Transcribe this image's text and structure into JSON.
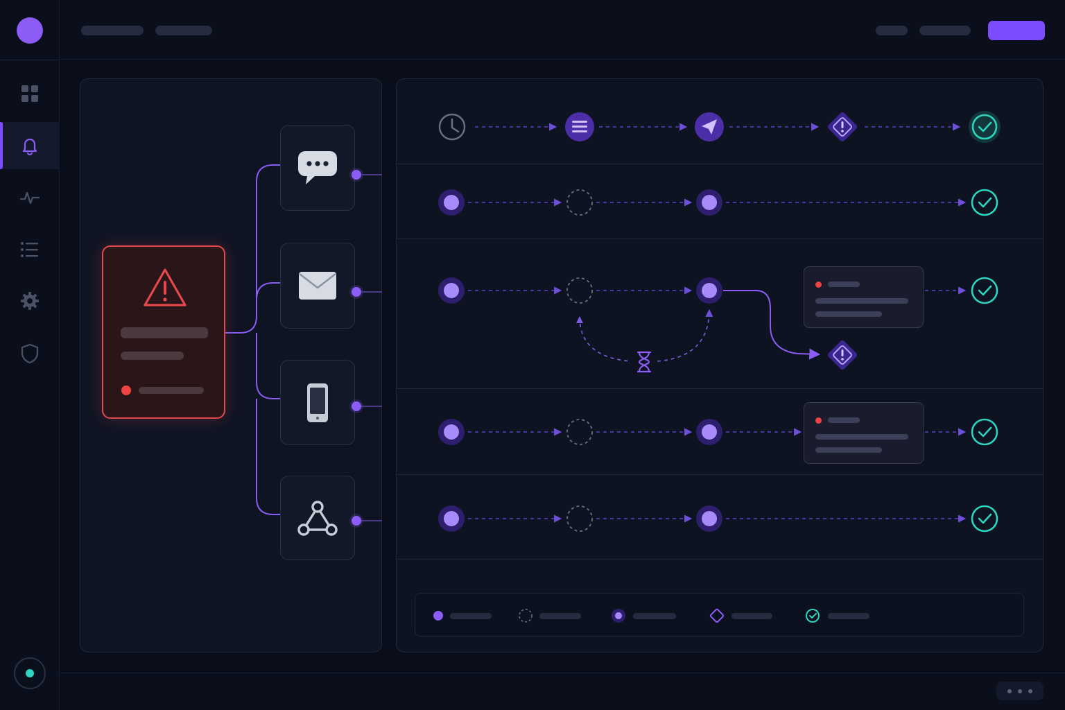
{
  "theme": {
    "background": "#0a0e1b",
    "accent": "#8b5cf6",
    "accent_strong": "#7c4dff",
    "success": "#2dd4bf",
    "danger": "#e5484d"
  },
  "sidebar": {
    "items": [
      {
        "icon": "grid-icon",
        "active": false
      },
      {
        "icon": "bell-icon",
        "active": true
      },
      {
        "icon": "activity-icon",
        "active": false
      },
      {
        "icon": "list-icon",
        "active": false
      },
      {
        "icon": "gear-icon",
        "active": false
      },
      {
        "icon": "shield-icon",
        "active": false
      }
    ],
    "status_indicator": {
      "icon": "status-dot-icon",
      "color": "#2dd4bf"
    }
  },
  "alert": {
    "icon": "warning-triangle-icon",
    "severity_color": "#e5484d"
  },
  "channels": [
    {
      "id": "chat",
      "icon": "chat-bubble-icon"
    },
    {
      "id": "email",
      "icon": "mail-envelope-icon"
    },
    {
      "id": "sms",
      "icon": "mobile-phone-icon"
    },
    {
      "id": "webhook",
      "icon": "webhook-icon"
    }
  ],
  "pipeline": {
    "step_icons": [
      "clock-icon",
      "list-icon",
      "send-icon",
      "diamond-warning-icon",
      "check-circle-icon"
    ],
    "rows": [
      {
        "nodes": [
          "trigger",
          "pending",
          "delivered",
          "done"
        ]
      },
      {
        "nodes": [
          "trigger",
          "pending",
          "delivered",
          "escalation",
          "done"
        ],
        "retry": {
          "icon": "hourglass-icon"
        }
      },
      {
        "nodes": [
          "trigger",
          "pending",
          "delivered",
          "detail",
          "done"
        ]
      },
      {
        "nodes": [
          "trigger",
          "pending",
          "delivered",
          "done"
        ]
      }
    ]
  },
  "legend": {
    "items": [
      {
        "icon": "filled-dot-icon"
      },
      {
        "icon": "dashed-circle-icon"
      },
      {
        "icon": "ringed-dot-icon"
      },
      {
        "icon": "diamond-icon"
      },
      {
        "icon": "check-circle-icon"
      }
    ]
  },
  "footer": {
    "more_icon": "more-dots-icon"
  }
}
